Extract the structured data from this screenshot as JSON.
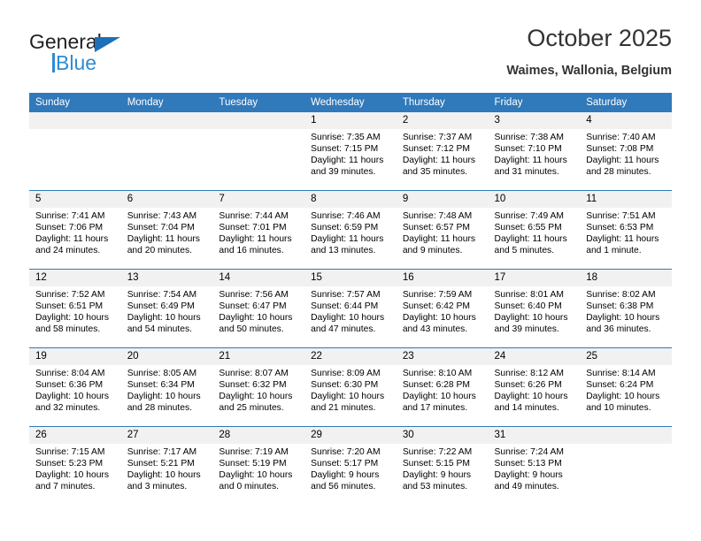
{
  "brand": {
    "name_top": "General",
    "name_bottom": "Blue",
    "triangle_color": "#1d6fb8",
    "blue_color": "#2e8bd4",
    "dark_color": "#231f20"
  },
  "header": {
    "title": "October 2025",
    "location": "Waimes, Wallonia, Belgium"
  },
  "theme": {
    "header_row_bg": "#3079ba",
    "header_row_text": "#ffffff",
    "daynum_bg": "#f1f1f1",
    "row_divider": "#3079ba"
  },
  "calendar": {
    "weekday_headers": [
      "Sunday",
      "Monday",
      "Tuesday",
      "Wednesday",
      "Thursday",
      "Friday",
      "Saturday"
    ],
    "labels": {
      "sunrise": "Sunrise:",
      "sunset": "Sunset:",
      "daylight": "Daylight:"
    },
    "weeks": [
      [
        {
          "day": "",
          "empty": true
        },
        {
          "day": "",
          "empty": true
        },
        {
          "day": "",
          "empty": true
        },
        {
          "day": "1",
          "sunrise": "Sunrise: 7:35 AM",
          "sunset": "Sunset: 7:15 PM",
          "daylight_1": "Daylight: 11 hours",
          "daylight_2": "and 39 minutes."
        },
        {
          "day": "2",
          "sunrise": "Sunrise: 7:37 AM",
          "sunset": "Sunset: 7:12 PM",
          "daylight_1": "Daylight: 11 hours",
          "daylight_2": "and 35 minutes."
        },
        {
          "day": "3",
          "sunrise": "Sunrise: 7:38 AM",
          "sunset": "Sunset: 7:10 PM",
          "daylight_1": "Daylight: 11 hours",
          "daylight_2": "and 31 minutes."
        },
        {
          "day": "4",
          "sunrise": "Sunrise: 7:40 AM",
          "sunset": "Sunset: 7:08 PM",
          "daylight_1": "Daylight: 11 hours",
          "daylight_2": "and 28 minutes."
        }
      ],
      [
        {
          "day": "5",
          "sunrise": "Sunrise: 7:41 AM",
          "sunset": "Sunset: 7:06 PM",
          "daylight_1": "Daylight: 11 hours",
          "daylight_2": "and 24 minutes."
        },
        {
          "day": "6",
          "sunrise": "Sunrise: 7:43 AM",
          "sunset": "Sunset: 7:04 PM",
          "daylight_1": "Daylight: 11 hours",
          "daylight_2": "and 20 minutes."
        },
        {
          "day": "7",
          "sunrise": "Sunrise: 7:44 AM",
          "sunset": "Sunset: 7:01 PM",
          "daylight_1": "Daylight: 11 hours",
          "daylight_2": "and 16 minutes."
        },
        {
          "day": "8",
          "sunrise": "Sunrise: 7:46 AM",
          "sunset": "Sunset: 6:59 PM",
          "daylight_1": "Daylight: 11 hours",
          "daylight_2": "and 13 minutes."
        },
        {
          "day": "9",
          "sunrise": "Sunrise: 7:48 AM",
          "sunset": "Sunset: 6:57 PM",
          "daylight_1": "Daylight: 11 hours",
          "daylight_2": "and 9 minutes."
        },
        {
          "day": "10",
          "sunrise": "Sunrise: 7:49 AM",
          "sunset": "Sunset: 6:55 PM",
          "daylight_1": "Daylight: 11 hours",
          "daylight_2": "and 5 minutes."
        },
        {
          "day": "11",
          "sunrise": "Sunrise: 7:51 AM",
          "sunset": "Sunset: 6:53 PM",
          "daylight_1": "Daylight: 11 hours",
          "daylight_2": "and 1 minute."
        }
      ],
      [
        {
          "day": "12",
          "sunrise": "Sunrise: 7:52 AM",
          "sunset": "Sunset: 6:51 PM",
          "daylight_1": "Daylight: 10 hours",
          "daylight_2": "and 58 minutes."
        },
        {
          "day": "13",
          "sunrise": "Sunrise: 7:54 AM",
          "sunset": "Sunset: 6:49 PM",
          "daylight_1": "Daylight: 10 hours",
          "daylight_2": "and 54 minutes."
        },
        {
          "day": "14",
          "sunrise": "Sunrise: 7:56 AM",
          "sunset": "Sunset: 6:47 PM",
          "daylight_1": "Daylight: 10 hours",
          "daylight_2": "and 50 minutes."
        },
        {
          "day": "15",
          "sunrise": "Sunrise: 7:57 AM",
          "sunset": "Sunset: 6:44 PM",
          "daylight_1": "Daylight: 10 hours",
          "daylight_2": "and 47 minutes."
        },
        {
          "day": "16",
          "sunrise": "Sunrise: 7:59 AM",
          "sunset": "Sunset: 6:42 PM",
          "daylight_1": "Daylight: 10 hours",
          "daylight_2": "and 43 minutes."
        },
        {
          "day": "17",
          "sunrise": "Sunrise: 8:01 AM",
          "sunset": "Sunset: 6:40 PM",
          "daylight_1": "Daylight: 10 hours",
          "daylight_2": "and 39 minutes."
        },
        {
          "day": "18",
          "sunrise": "Sunrise: 8:02 AM",
          "sunset": "Sunset: 6:38 PM",
          "daylight_1": "Daylight: 10 hours",
          "daylight_2": "and 36 minutes."
        }
      ],
      [
        {
          "day": "19",
          "sunrise": "Sunrise: 8:04 AM",
          "sunset": "Sunset: 6:36 PM",
          "daylight_1": "Daylight: 10 hours",
          "daylight_2": "and 32 minutes."
        },
        {
          "day": "20",
          "sunrise": "Sunrise: 8:05 AM",
          "sunset": "Sunset: 6:34 PM",
          "daylight_1": "Daylight: 10 hours",
          "daylight_2": "and 28 minutes."
        },
        {
          "day": "21",
          "sunrise": "Sunrise: 8:07 AM",
          "sunset": "Sunset: 6:32 PM",
          "daylight_1": "Daylight: 10 hours",
          "daylight_2": "and 25 minutes."
        },
        {
          "day": "22",
          "sunrise": "Sunrise: 8:09 AM",
          "sunset": "Sunset: 6:30 PM",
          "daylight_1": "Daylight: 10 hours",
          "daylight_2": "and 21 minutes."
        },
        {
          "day": "23",
          "sunrise": "Sunrise: 8:10 AM",
          "sunset": "Sunset: 6:28 PM",
          "daylight_1": "Daylight: 10 hours",
          "daylight_2": "and 17 minutes."
        },
        {
          "day": "24",
          "sunrise": "Sunrise: 8:12 AM",
          "sunset": "Sunset: 6:26 PM",
          "daylight_1": "Daylight: 10 hours",
          "daylight_2": "and 14 minutes."
        },
        {
          "day": "25",
          "sunrise": "Sunrise: 8:14 AM",
          "sunset": "Sunset: 6:24 PM",
          "daylight_1": "Daylight: 10 hours",
          "daylight_2": "and 10 minutes."
        }
      ],
      [
        {
          "day": "26",
          "sunrise": "Sunrise: 7:15 AM",
          "sunset": "Sunset: 5:23 PM",
          "daylight_1": "Daylight: 10 hours",
          "daylight_2": "and 7 minutes."
        },
        {
          "day": "27",
          "sunrise": "Sunrise: 7:17 AM",
          "sunset": "Sunset: 5:21 PM",
          "daylight_1": "Daylight: 10 hours",
          "daylight_2": "and 3 minutes."
        },
        {
          "day": "28",
          "sunrise": "Sunrise: 7:19 AM",
          "sunset": "Sunset: 5:19 PM",
          "daylight_1": "Daylight: 10 hours",
          "daylight_2": "and 0 minutes."
        },
        {
          "day": "29",
          "sunrise": "Sunrise: 7:20 AM",
          "sunset": "Sunset: 5:17 PM",
          "daylight_1": "Daylight: 9 hours",
          "daylight_2": "and 56 minutes."
        },
        {
          "day": "30",
          "sunrise": "Sunrise: 7:22 AM",
          "sunset": "Sunset: 5:15 PM",
          "daylight_1": "Daylight: 9 hours",
          "daylight_2": "and 53 minutes."
        },
        {
          "day": "31",
          "sunrise": "Sunrise: 7:24 AM",
          "sunset": "Sunset: 5:13 PM",
          "daylight_1": "Daylight: 9 hours",
          "daylight_2": "and 49 minutes."
        },
        {
          "day": "",
          "empty": true
        }
      ]
    ]
  }
}
